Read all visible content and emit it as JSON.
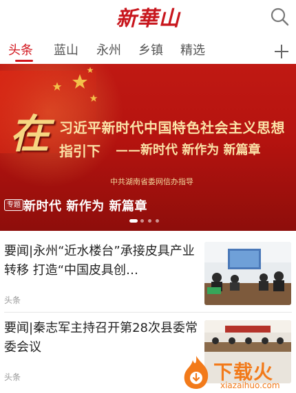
{
  "header": {
    "logo_text": "新華山"
  },
  "tabs": [
    {
      "label": "头条",
      "active": true
    },
    {
      "label": "蓝山",
      "active": false
    },
    {
      "label": "永州",
      "active": false
    },
    {
      "label": "乡镇",
      "active": false
    },
    {
      "label": "精选",
      "active": false
    }
  ],
  "banner": {
    "big_char": "在",
    "line1": "习近平新时代中国特色社会主义思想",
    "line2": "指引下",
    "line3": "——新时代 新作为 新篇章",
    "guide": "中共湖南省委网信办指导",
    "tag": "专题",
    "title": "新时代 新作为 新篇章",
    "slide_count": 4,
    "active_slide": 1
  },
  "news": [
    {
      "title": "要闻|永州“近水楼台”承接皮具产业转移 打造“中国皮具创…",
      "source": "头条"
    },
    {
      "title": "要闻|秦志军主持召开第28次县委常委会议",
      "source": "头条"
    }
  ],
  "watermark": {
    "text": "下载火",
    "sub": "xiazaihuo.com"
  },
  "colors": {
    "accent": "#d1141c",
    "banner_red": "#b5130f",
    "gold_text": "#fbe3a8",
    "watermark": "#f27a1a"
  }
}
